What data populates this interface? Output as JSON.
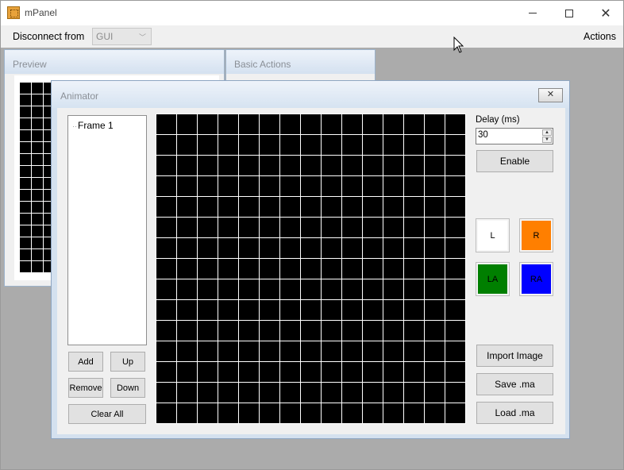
{
  "app": {
    "title": "mPanel"
  },
  "menubar": {
    "disconnect_label": "Disconnect from",
    "gui_select_value": "GUI",
    "actions_label": "Actions"
  },
  "panels": {
    "preview_title": "Preview",
    "basic_actions_title": "Basic Actions"
  },
  "animator": {
    "title": "Animator",
    "frames": [
      "Frame 1"
    ],
    "buttons": {
      "add": "Add",
      "up": "Up",
      "remove": "Remove",
      "down": "Down",
      "clear_all": "Clear All"
    },
    "delay": {
      "label": "Delay (ms)",
      "value": "30"
    },
    "enable_label": "Enable",
    "color_slots": [
      {
        "label": "L",
        "color": "#ffffff"
      },
      {
        "label": "R",
        "color": "#ff7f00"
      },
      {
        "label": "LA",
        "color": "#007f00"
      },
      {
        "label": "RA",
        "color": "#0000ff"
      }
    ],
    "import_label": "Import Image",
    "save_label": "Save .ma",
    "load_label": "Load .ma",
    "grid": {
      "rows": 15,
      "cols": 15,
      "cell_color": "#000000"
    }
  },
  "preview": {
    "grid": {
      "rows": 16,
      "cols": 16,
      "cell_color": "#000000"
    }
  }
}
